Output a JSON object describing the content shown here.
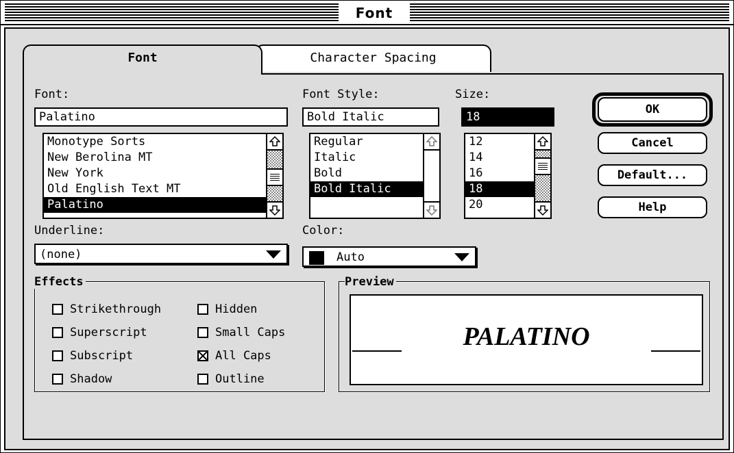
{
  "window": {
    "title": "Font"
  },
  "tabs": [
    {
      "label": "Font",
      "active": true
    },
    {
      "label": "Character Spacing",
      "active": false
    }
  ],
  "font": {
    "label": "Font:",
    "value": "Palatino",
    "list": [
      "Monotype Sorts",
      "New Berolina MT",
      "New York",
      "Old English Text MT",
      "Palatino"
    ],
    "selected": "Palatino"
  },
  "font_style": {
    "label": "Font Style:",
    "value": "Bold Italic",
    "list": [
      "Regular",
      "Italic",
      "Bold",
      "Bold Italic"
    ],
    "selected": "Bold Italic"
  },
  "size": {
    "label": "Size:",
    "value": "18",
    "list": [
      "12",
      "14",
      "16",
      "18",
      "20"
    ],
    "selected": "18"
  },
  "underline": {
    "label": "Underline:",
    "value": "(none)"
  },
  "color": {
    "label": "Color:",
    "value": "Auto",
    "swatch": "#000000"
  },
  "buttons": {
    "ok": "OK",
    "cancel": "Cancel",
    "default": "Default...",
    "help": "Help"
  },
  "effects": {
    "title": "Effects",
    "items": [
      {
        "label": "Strikethrough",
        "checked": false
      },
      {
        "label": "Superscript",
        "checked": false
      },
      {
        "label": "Subscript",
        "checked": false
      },
      {
        "label": "Shadow",
        "checked": false
      },
      {
        "label": "Hidden",
        "checked": false
      },
      {
        "label": "Small Caps",
        "checked": false
      },
      {
        "label": "All Caps",
        "checked": true
      },
      {
        "label": "Outline",
        "checked": false
      }
    ]
  },
  "preview": {
    "title": "Preview",
    "text": "PALATINO"
  },
  "icons": [
    "scroll-up-arrow-icon",
    "scroll-down-arrow-icon",
    "popup-triangle-icon",
    "checkbox-x-icon"
  ]
}
